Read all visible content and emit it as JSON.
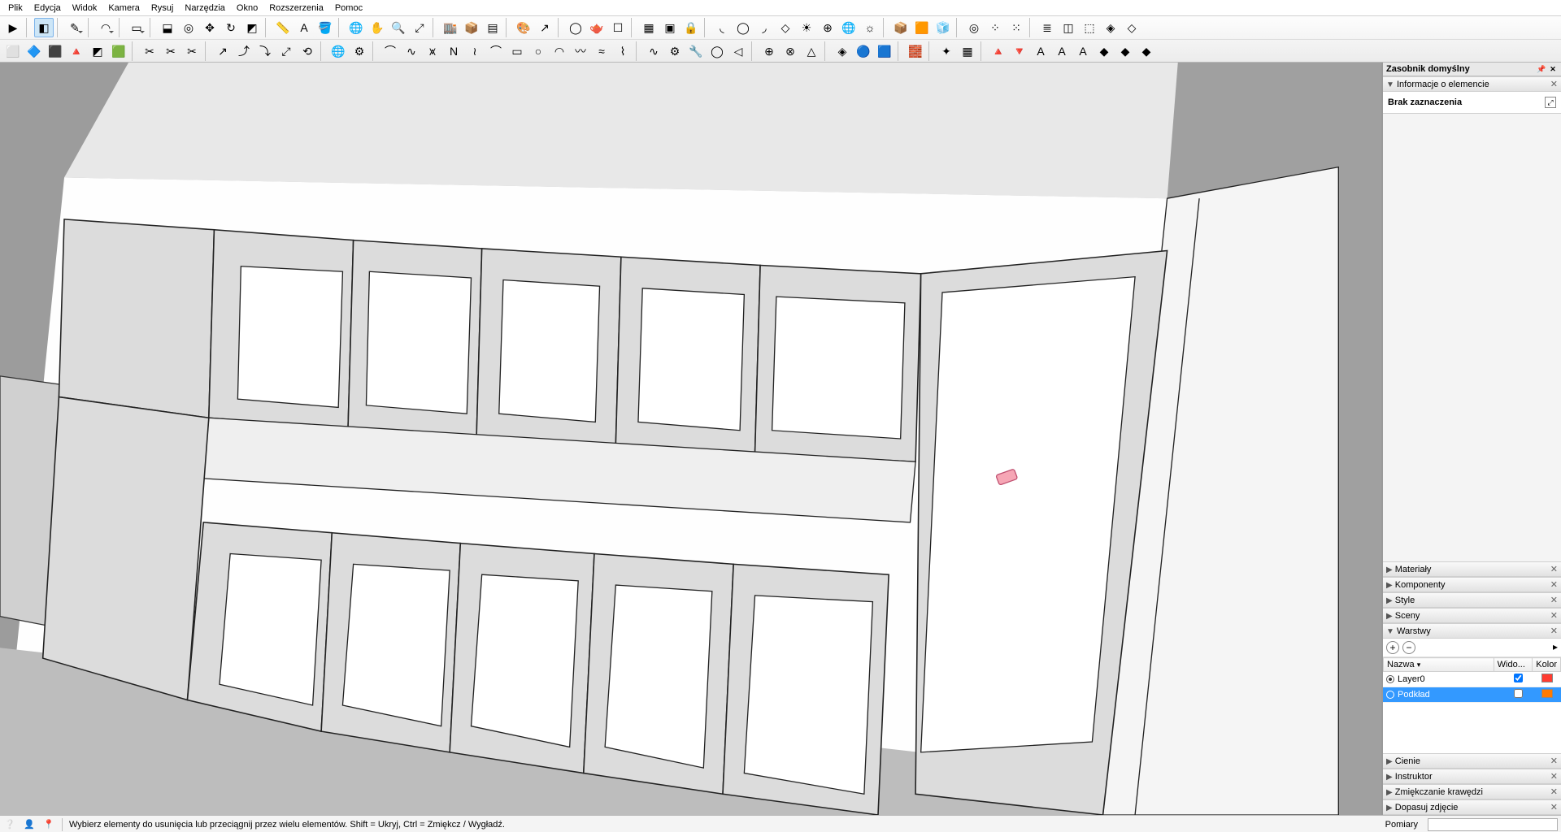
{
  "menu": [
    "Plik",
    "Edycja",
    "Widok",
    "Kamera",
    "Rysuj",
    "Narzędzia",
    "Okno",
    "Rozszerzenia",
    "Pomoc"
  ],
  "tray": {
    "title": "Zasobnik domyślny",
    "entity_panel": "Informacje o elemencie",
    "entity_status": "Brak zaznaczenia",
    "panels_collapsed_top": [
      "Materiały",
      "Komponenty",
      "Style",
      "Sceny"
    ],
    "layers_panel": "Warstwy",
    "layers_headers": [
      "Nazwa",
      "Wido...",
      "Kolor"
    ],
    "layers": [
      {
        "name": "Layer0",
        "visible": true,
        "color": "#ff3b30",
        "active": true,
        "selected": false
      },
      {
        "name": "Podkład",
        "visible": false,
        "color": "#ff7a00",
        "active": false,
        "selected": true
      }
    ],
    "panels_collapsed_bottom": [
      "Cienie",
      "Instruktor",
      "Zmiękczanie krawędzi",
      "Dopasuj zdjęcie"
    ]
  },
  "status": {
    "hint": "Wybierz elementy do usunięcia lub przeciągnij przez wielu elementów. Shift = Ukryj, Ctrl = Zmiękcz / Wygładź.",
    "measure_label": "Pomiary"
  },
  "toolbar_icons_row1": [
    {
      "n": "select",
      "s": "▶",
      "sep": false
    },
    {
      "n": "sep1",
      "sep": true
    },
    {
      "n": "eraser",
      "s": "◧",
      "sel": true
    },
    {
      "n": "sep1b",
      "sep": true
    },
    {
      "n": "line",
      "s": "✎",
      "dd": true
    },
    {
      "n": "sep2",
      "sep": true
    },
    {
      "n": "arc",
      "s": "◠",
      "dd": true
    },
    {
      "n": "sep3",
      "sep": true
    },
    {
      "n": "rect",
      "s": "▭",
      "dd": true
    },
    {
      "n": "sep4",
      "sep": true
    },
    {
      "n": "pushpull",
      "s": "⬓"
    },
    {
      "n": "offset",
      "s": "◎"
    },
    {
      "n": "move",
      "s": "✥"
    },
    {
      "n": "rotate",
      "s": "↻"
    },
    {
      "n": "scale",
      "s": "◩"
    },
    {
      "n": "sep5",
      "sep": true
    },
    {
      "n": "tape",
      "s": "📏"
    },
    {
      "n": "text",
      "s": "A"
    },
    {
      "n": "paint",
      "s": "🪣"
    },
    {
      "n": "sep6",
      "sep": true
    },
    {
      "n": "orbit",
      "s": "🌐"
    },
    {
      "n": "pan",
      "s": "✋"
    },
    {
      "n": "zoom",
      "s": "🔍"
    },
    {
      "n": "zoom-ext",
      "s": "⤢"
    },
    {
      "n": "sep7",
      "sep": true
    },
    {
      "n": "warehouse",
      "s": "🏬"
    },
    {
      "n": "ext-wh",
      "s": "📦"
    },
    {
      "n": "layers",
      "s": "▤"
    },
    {
      "n": "sep8",
      "sep": true
    },
    {
      "n": "palette",
      "s": "🎨"
    },
    {
      "n": "picker",
      "s": "↗"
    },
    {
      "n": "sep9",
      "sep": true
    },
    {
      "n": "circle1",
      "s": "◯"
    },
    {
      "n": "teapot",
      "s": "🫖"
    },
    {
      "n": "box3",
      "s": "☐"
    },
    {
      "n": "sep10",
      "sep": true
    },
    {
      "n": "grp-a",
      "s": "▦"
    },
    {
      "n": "grp-b",
      "s": "▣"
    },
    {
      "n": "lock",
      "s": "🔒"
    },
    {
      "n": "sep11",
      "sep": true
    },
    {
      "n": "curve1",
      "s": "◟"
    },
    {
      "n": "curve2",
      "s": "◯"
    },
    {
      "n": "curve3",
      "s": "◞"
    },
    {
      "n": "curve4",
      "s": "◇"
    },
    {
      "n": "sun",
      "s": "☀"
    },
    {
      "n": "grid-sphere",
      "s": "⊕"
    },
    {
      "n": "globe",
      "s": "🌐"
    },
    {
      "n": "bright",
      "s": "☼"
    },
    {
      "n": "sep12",
      "sep": true
    },
    {
      "n": "box-a",
      "s": "📦"
    },
    {
      "n": "box-b",
      "s": "🟧"
    },
    {
      "n": "box-c",
      "s": "🧊"
    },
    {
      "n": "sep13",
      "sep": true
    },
    {
      "n": "target",
      "s": "◎"
    },
    {
      "n": "dots1",
      "s": "⁘"
    },
    {
      "n": "dots2",
      "s": "⁙"
    },
    {
      "n": "sep14",
      "sep": true
    },
    {
      "n": "layer1",
      "s": "≣"
    },
    {
      "n": "layer2",
      "s": "◫"
    },
    {
      "n": "layer3",
      "s": "⬚"
    },
    {
      "n": "layer4",
      "s": "◈"
    },
    {
      "n": "layer5",
      "s": "◇"
    }
  ],
  "toolbar_icons_row2": [
    {
      "n": "cube1",
      "s": "⬜"
    },
    {
      "n": "cube2",
      "s": "🔷"
    },
    {
      "n": "cube3",
      "s": "⬛"
    },
    {
      "n": "cube4",
      "s": "🔺"
    },
    {
      "n": "cube5",
      "s": "◩"
    },
    {
      "n": "cube6",
      "s": "🟩"
    },
    {
      "n": "sep1",
      "sep": true
    },
    {
      "n": "ed1",
      "s": "✂"
    },
    {
      "n": "ed2",
      "s": "✂"
    },
    {
      "n": "ed3",
      "s": "✂"
    },
    {
      "n": "sep2",
      "sep": true
    },
    {
      "n": "mv1",
      "s": "↗"
    },
    {
      "n": "mv2",
      "s": "⤴"
    },
    {
      "n": "mv3",
      "s": "⤵"
    },
    {
      "n": "mv4",
      "s": "⤢"
    },
    {
      "n": "mv5",
      "s": "⟲"
    },
    {
      "n": "sep3",
      "sep": true
    },
    {
      "n": "globe2",
      "s": "🌐"
    },
    {
      "n": "gear",
      "s": "⚙"
    },
    {
      "n": "sep4",
      "sep": true
    },
    {
      "n": "c1",
      "s": "⌒"
    },
    {
      "n": "c2",
      "s": "∿"
    },
    {
      "n": "c3",
      "s": "⩙"
    },
    {
      "n": "c4",
      "s": "N"
    },
    {
      "n": "c5",
      "s": "≀"
    },
    {
      "n": "c6",
      "s": "⌒"
    },
    {
      "n": "c7",
      "s": "▭"
    },
    {
      "n": "c8",
      "s": "○"
    },
    {
      "n": "c9",
      "s": "◠"
    },
    {
      "n": "c10",
      "s": "〰"
    },
    {
      "n": "c11",
      "s": "≈"
    },
    {
      "n": "c12",
      "s": "⌇"
    },
    {
      "n": "sep5",
      "sep": true
    },
    {
      "n": "d1",
      "s": "∿"
    },
    {
      "n": "d2",
      "s": "⚙"
    },
    {
      "n": "d3",
      "s": "🔧"
    },
    {
      "n": "d4",
      "s": "◯"
    },
    {
      "n": "d5",
      "s": "◁"
    },
    {
      "n": "sep6",
      "sep": true
    },
    {
      "n": "e1",
      "s": "⊕"
    },
    {
      "n": "e2",
      "s": "⊗"
    },
    {
      "n": "e3",
      "s": "△"
    },
    {
      "n": "sep7",
      "sep": true
    },
    {
      "n": "f1",
      "s": "◈"
    },
    {
      "n": "f2",
      "s": "🔵"
    },
    {
      "n": "f3",
      "s": "🟦"
    },
    {
      "n": "sep8",
      "sep": true
    },
    {
      "n": "brick",
      "s": "🧱"
    },
    {
      "n": "sep9",
      "sep": true
    },
    {
      "n": "g1",
      "s": "✦"
    },
    {
      "n": "g2",
      "s": "▦"
    },
    {
      "n": "sep10",
      "sep": true
    },
    {
      "n": "h1",
      "s": "🔺"
    },
    {
      "n": "h2",
      "s": "🔻"
    },
    {
      "n": "h3",
      "s": "A"
    },
    {
      "n": "h4",
      "s": "A"
    },
    {
      "n": "h5",
      "s": "A"
    },
    {
      "n": "h6",
      "s": "◆"
    },
    {
      "n": "h7",
      "s": "◆"
    },
    {
      "n": "h8",
      "s": "◆"
    }
  ]
}
